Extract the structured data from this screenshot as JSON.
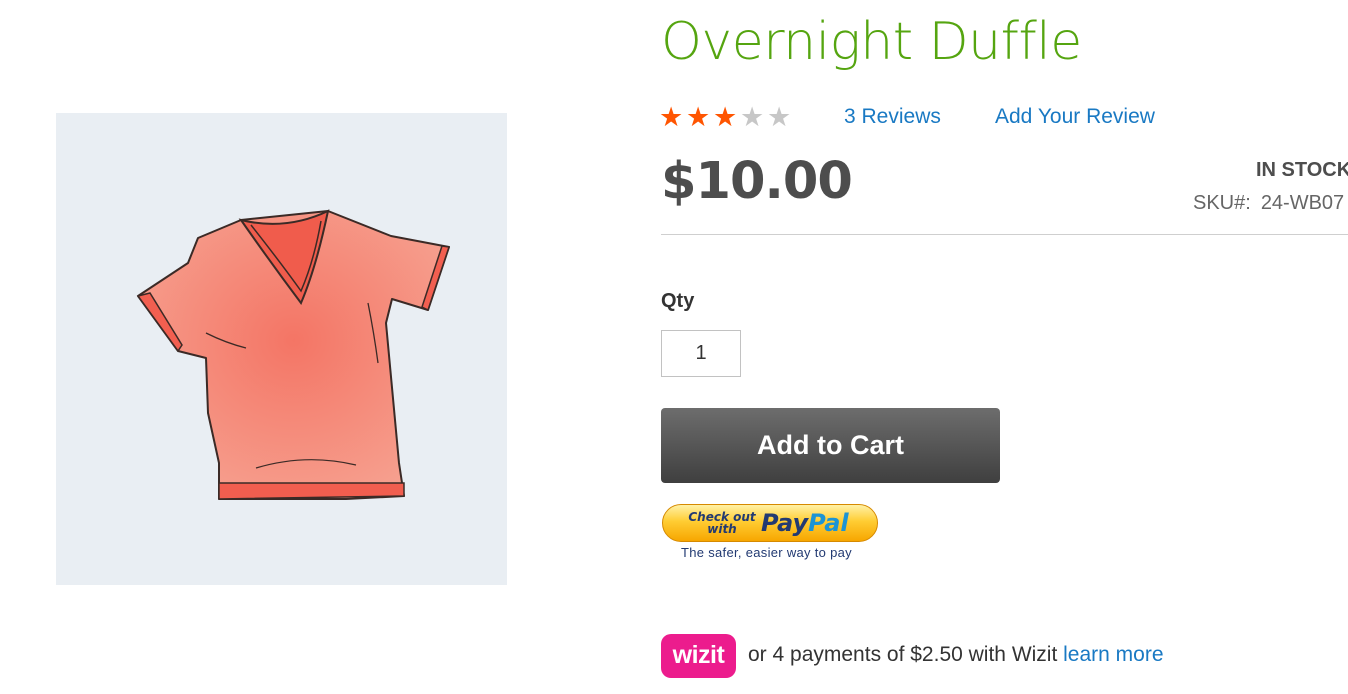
{
  "product": {
    "title": "Overnight Duffle",
    "rating": {
      "stars_filled": 3,
      "stars_total": 5
    },
    "reviews_link": "3  Reviews",
    "add_review_link": "Add Your Review",
    "price": "$10.00",
    "stock_status": "IN STOCK",
    "sku_label": "SKU#:",
    "sku_value": "24-WB07"
  },
  "form": {
    "qty_label": "Qty",
    "qty_value": "1",
    "add_to_cart_label": "Add to Cart"
  },
  "paypal": {
    "check_text": "Check out with",
    "logo_pay": "Pay",
    "logo_pal": "Pal",
    "tagline": "The safer, easier way to pay"
  },
  "wizit": {
    "logo_text": "wizit",
    "message": "or 4 payments of $2.50 with Wizit ",
    "learn_more": "learn more"
  },
  "colors": {
    "title_green": "#55a510",
    "link_blue": "#1979c3",
    "star_filled": "#ff5501",
    "star_empty": "#c7c7c7",
    "wizit_pink": "#ec1c8d"
  }
}
